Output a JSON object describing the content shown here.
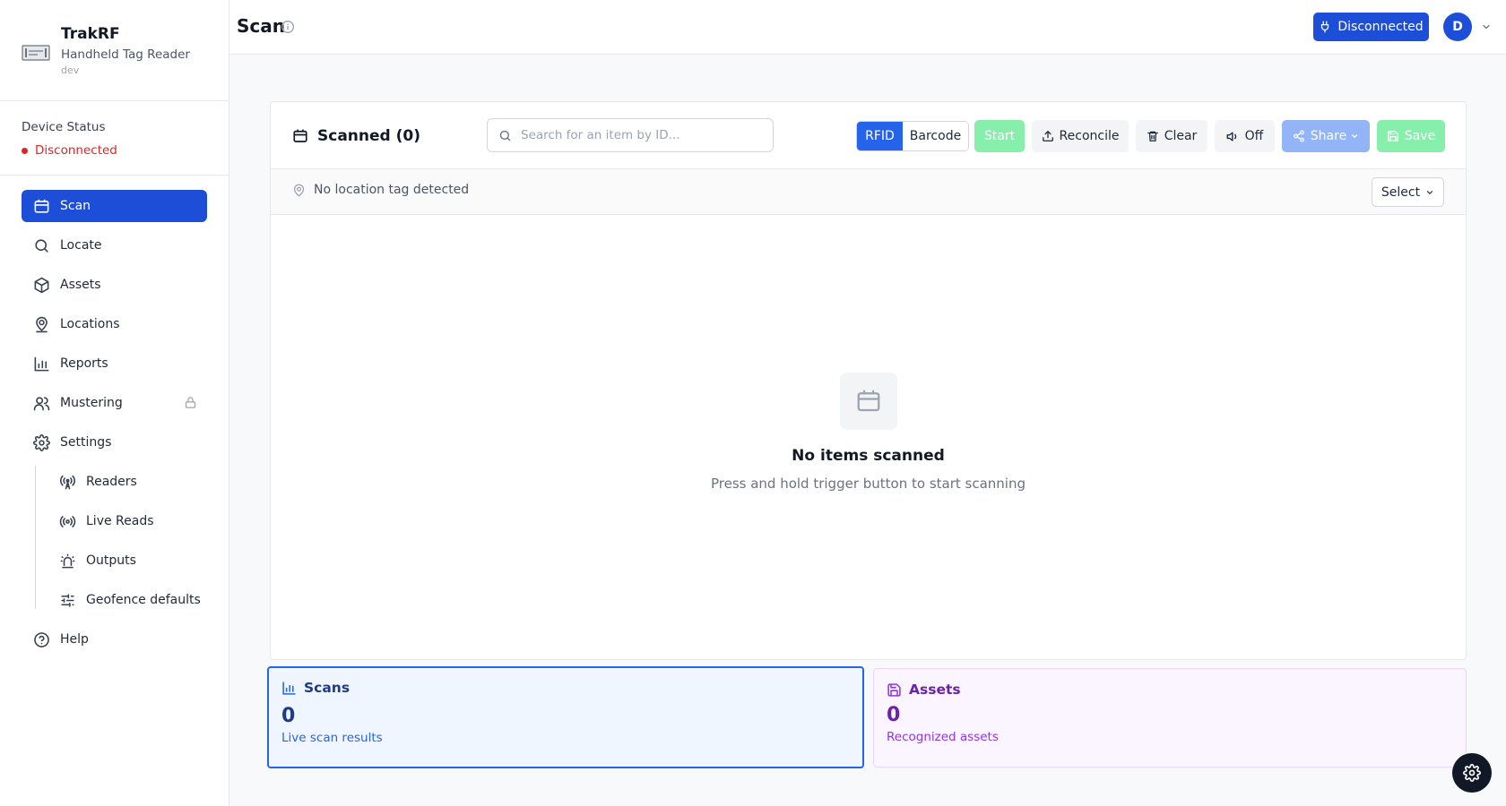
{
  "brand": {
    "name": "TrakRF",
    "subtitle": "Handheld Tag Reader",
    "env": "dev"
  },
  "device_status": {
    "label": "Device Status",
    "value": "Disconnected",
    "color": "#dc2626"
  },
  "sidebar": {
    "items": [
      {
        "label": "Scan",
        "icon": "scan-icon",
        "active": true
      },
      {
        "label": "Locate",
        "icon": "search-icon"
      },
      {
        "label": "Assets",
        "icon": "box-icon"
      },
      {
        "label": "Locations",
        "icon": "map-pin-user-icon"
      },
      {
        "label": "Reports",
        "icon": "bar-chart-icon"
      },
      {
        "label": "Mustering",
        "icon": "users-icon",
        "locked": true
      },
      {
        "label": "Settings",
        "icon": "gear-icon"
      }
    ],
    "sub_items": [
      {
        "label": "Readers",
        "icon": "antenna-icon"
      },
      {
        "label": "Live Reads",
        "icon": "broadcast-icon"
      },
      {
        "label": "Outputs",
        "icon": "siren-icon"
      },
      {
        "label": "Geofence defaults",
        "icon": "sliders-icon"
      }
    ],
    "help": {
      "label": "Help",
      "icon": "help-circle-icon"
    }
  },
  "header": {
    "title": "Scan",
    "connection_button": "Disconnected",
    "avatar_initial": "D"
  },
  "toolbar": {
    "scanned_label": "Scanned (0)",
    "search_placeholder": "Search for an item by ID...",
    "mode_rfid": "RFID",
    "mode_barcode": "Barcode",
    "start": "Start",
    "reconcile": "Reconcile",
    "clear": "Clear",
    "sound": "Off",
    "share": "Share",
    "save": "Save"
  },
  "location_bar": {
    "text": "No location tag detected",
    "select_label": "Select"
  },
  "empty_state": {
    "title": "No items scanned",
    "subtitle": "Press and hold trigger button to start scanning"
  },
  "stats": {
    "scans": {
      "title": "Scans",
      "value": "0",
      "desc": "Live scan results"
    },
    "assets": {
      "title": "Assets",
      "value": "0",
      "desc": "Recognized assets"
    }
  },
  "colors": {
    "primary": "#1d4ed8",
    "accent_blue": "#2563eb",
    "success_light": "#86efac",
    "purple": "#6b21a8"
  }
}
